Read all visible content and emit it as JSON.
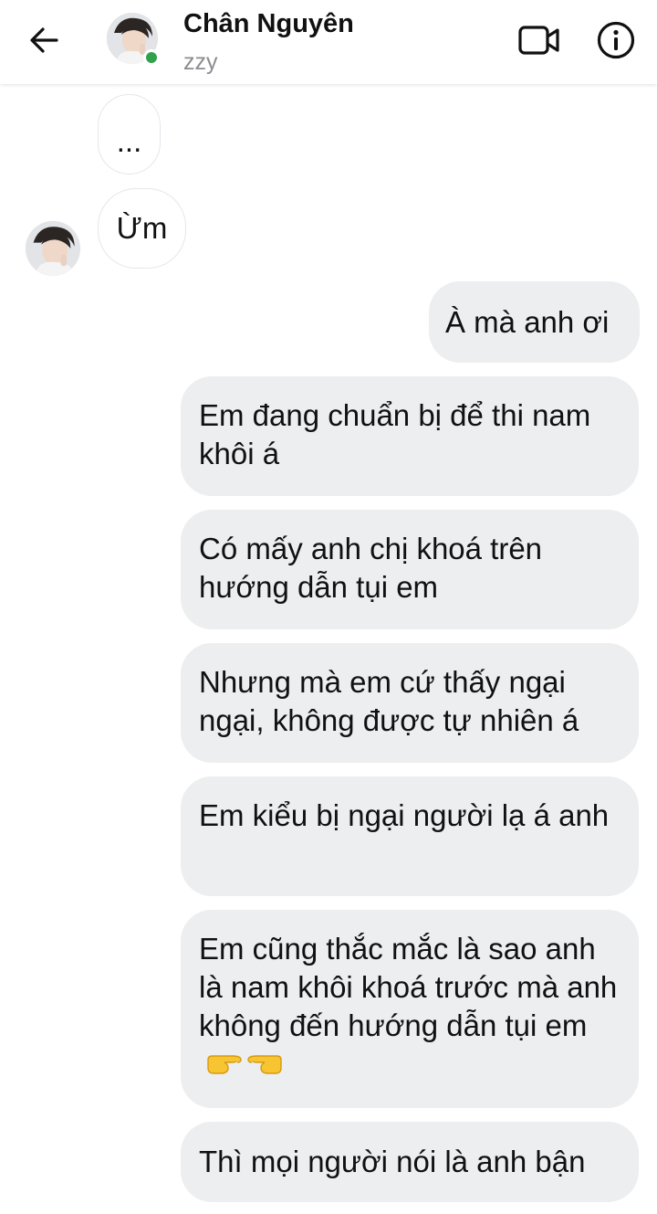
{
  "header": {
    "contact_name": "Chân Nguyên",
    "status": "zzy"
  },
  "colors": {
    "online": "#31a24c",
    "outgoing_bubble": "#eceeef",
    "incoming_border": "#e4e6eb",
    "status_text": "#8a8d91"
  },
  "messages": [
    {
      "sender": "contact",
      "text": "..."
    },
    {
      "sender": "contact",
      "text": "Ừm"
    },
    {
      "sender": "me",
      "text": "À mà anh ơi"
    },
    {
      "sender": "me",
      "text": "Em đang chuẩn bị để thi nam khôi á"
    },
    {
      "sender": "me",
      "text": "Có mấy anh chị khoá trên hướng dẫn tụi em"
    },
    {
      "sender": "me",
      "text": "Nhưng mà em cứ thấy ngại ngại, không được tự nhiên á"
    },
    {
      "sender": "me",
      "text": "Em kiểu bị ngại người lạ á anh"
    },
    {
      "sender": "me",
      "text": "Em cũng thắc mắc là sao anh là nam khôi khoá trước mà anh không đến hướng dẫn tụi em",
      "emoji": [
        "pointing-right-emoji",
        "pointing-left-emoji"
      ]
    },
    {
      "sender": "me",
      "text": "Thì mọi người nói là anh bận"
    }
  ],
  "icons": {
    "back": "arrow-left-icon",
    "video": "video-camera-icon",
    "info": "info-circle-icon"
  }
}
